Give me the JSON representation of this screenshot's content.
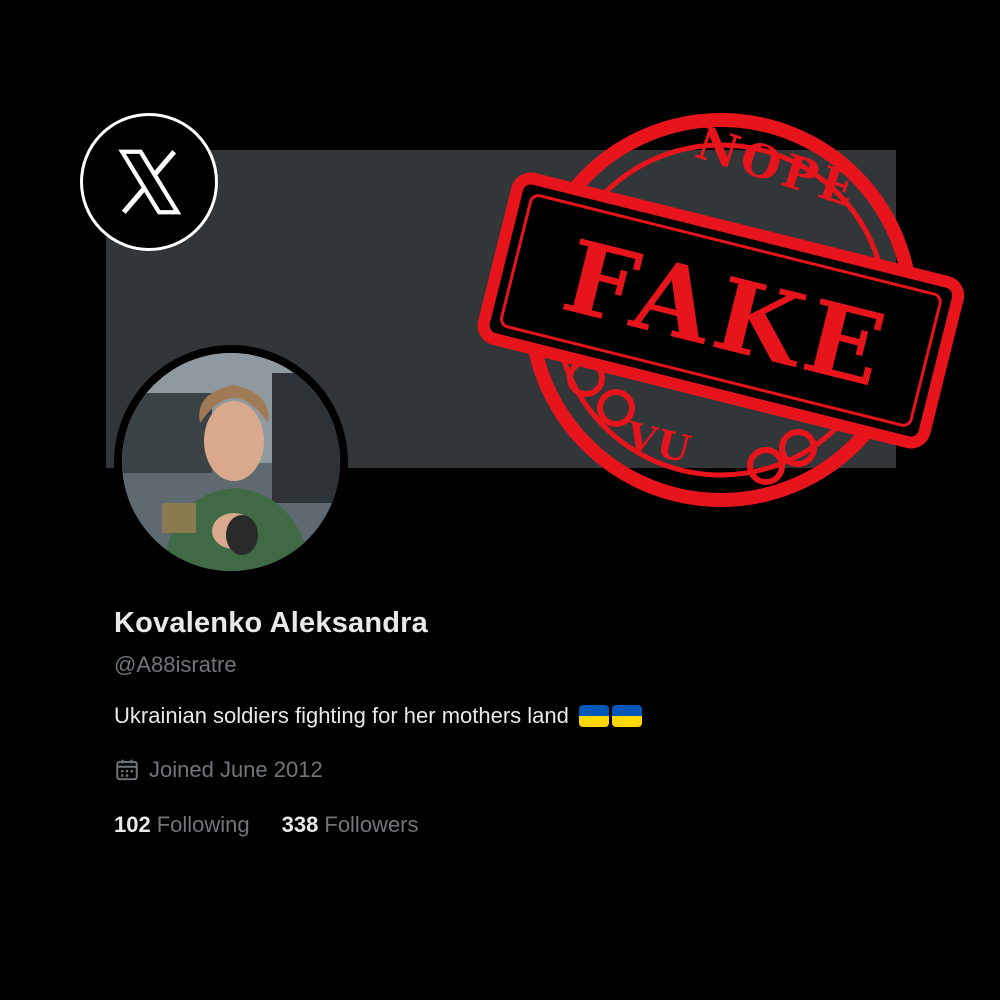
{
  "brand": {
    "logo_icon": "x-logo-icon"
  },
  "stamp": {
    "top_text": "NOPE",
    "main_text": "FAKE",
    "bottom_text": "VU",
    "color": "#e8141b"
  },
  "profile": {
    "avatar_icon": "profile-photo",
    "name": "Kovalenko Aleksandra",
    "handle": "@A88isratre",
    "bio": "Ukrainian soldiers fighting for her mothers land",
    "bio_emoji": [
      "ukraine-flag-icon",
      "ukraine-flag-icon"
    ],
    "joined_icon": "calendar-icon",
    "joined": "Joined June 2012",
    "following_count": "102",
    "following_label": "Following",
    "followers_count": "338",
    "followers_label": "Followers"
  },
  "colors": {
    "background": "#000000",
    "banner": "#333639",
    "text_primary": "#e7e9ea",
    "text_secondary": "#71767b",
    "flag_blue": "#0057b7",
    "flag_yellow": "#ffd700"
  }
}
